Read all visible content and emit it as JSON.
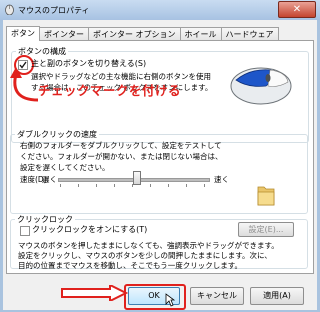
{
  "window": {
    "title": "マウスのプロパティ",
    "close_glyph": "✕"
  },
  "tabs": [
    {
      "label": "ボタン"
    },
    {
      "label": "ポインター"
    },
    {
      "label": "ポインター オプション"
    },
    {
      "label": "ホイール"
    },
    {
      "label": "ハードウェア"
    }
  ],
  "button_config": {
    "group_label": "ボタンの構成",
    "switch_label": "主と副のボタンを切り替える(S)",
    "switch_checked": true,
    "description": [
      "選択やドラッグなどの主な機能に右側のボタンを使用",
      "する場合は、このチェック ボックスをオンにします。"
    ]
  },
  "annotation": {
    "text": "チェックマークを付ける",
    "color": "#e0211d"
  },
  "double_click": {
    "group_label": "ダブルクリックの速度",
    "description": [
      "右側のフォルダーをダブルクリックして、設定をテストして",
      "ください。フォルダーが開かない、または閉じない場合は、",
      "設定を遅くしてください。"
    ],
    "speed_label": "速度(D):",
    "slow": "遅く",
    "fast": "速く"
  },
  "click_lock": {
    "group_label": "クリックロック",
    "checkbox_label": "クリックロックをオンにする(T)",
    "checked": false,
    "settings_button": "設定(E)...",
    "description": [
      "マウスのボタンを押したままにしなくても、強調表示やドラッグができます。",
      "設定をクリックし、マウスのボタンを少しの間押したままにします。次に、",
      "目的の位置までマウスを移動し、そこでもう一度クリックします。"
    ]
  },
  "footer": {
    "ok": "OK",
    "cancel": "キャンセル",
    "apply": "適用(A)"
  }
}
